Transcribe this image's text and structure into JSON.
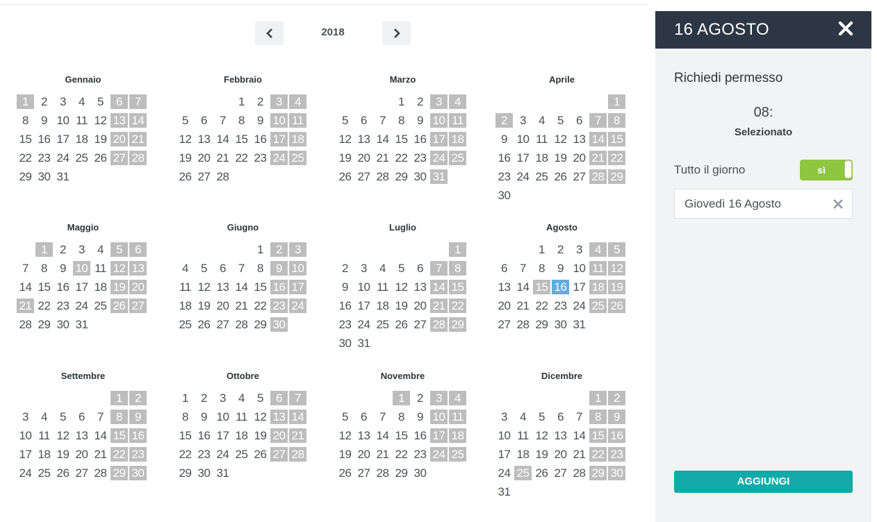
{
  "year_nav": {
    "year": "2018",
    "prev_icon": "chevron-left-icon",
    "next_icon": "chevron-right-icon"
  },
  "months": [
    {
      "name": "Gennaio",
      "offset": 0,
      "days": 31,
      "weekend": [
        1,
        6,
        7,
        13,
        14,
        20,
        21,
        27,
        28
      ],
      "holiday": []
    },
    {
      "name": "Febbraio",
      "offset": 3,
      "days": 28,
      "weekend": [
        3,
        4,
        10,
        11,
        17,
        18,
        24,
        25
      ],
      "holiday": []
    },
    {
      "name": "Marzo",
      "offset": 3,
      "days": 31,
      "weekend": [
        3,
        4,
        10,
        11,
        17,
        18,
        24,
        25,
        31
      ],
      "holiday": []
    },
    {
      "name": "Aprile",
      "offset": 6,
      "days": 30,
      "weekend": [
        1,
        2,
        7,
        8,
        14,
        15,
        21,
        22,
        28,
        29
      ],
      "holiday": []
    },
    {
      "name": "Maggio",
      "offset": 1,
      "days": 31,
      "weekend": [
        1,
        5,
        6,
        10,
        12,
        13,
        19,
        20,
        21,
        26,
        27
      ],
      "holiday": []
    },
    {
      "name": "Giugno",
      "offset": 4,
      "days": 30,
      "weekend": [
        2,
        3,
        9,
        10,
        16,
        17,
        23,
        24,
        30
      ],
      "holiday": []
    },
    {
      "name": "Luglio",
      "offset": 6,
      "days": 31,
      "weekend": [
        1,
        7,
        8,
        14,
        15,
        21,
        22,
        28,
        29
      ],
      "holiday": []
    },
    {
      "name": "Agosto",
      "offset": 2,
      "days": 31,
      "weekend": [
        4,
        5,
        11,
        12,
        15,
        18,
        19,
        25,
        26
      ],
      "holiday": [],
      "selected": 16
    },
    {
      "name": "Settembre",
      "offset": 5,
      "days": 30,
      "weekend": [
        1,
        2,
        8,
        9,
        15,
        16,
        22,
        23,
        29,
        30
      ],
      "holiday": []
    },
    {
      "name": "Ottobre",
      "offset": 0,
      "days": 31,
      "weekend": [
        6,
        7,
        13,
        14,
        20,
        21,
        27,
        28
      ],
      "holiday": []
    },
    {
      "name": "Novembre",
      "offset": 3,
      "days": 30,
      "weekend": [
        1,
        3,
        4,
        10,
        11,
        17,
        18,
        24,
        25
      ],
      "holiday": []
    },
    {
      "name": "Dicembre",
      "offset": 5,
      "days": 31,
      "weekend": [
        1,
        2,
        8,
        9,
        15,
        16,
        22,
        23,
        25,
        29,
        30
      ],
      "holiday": []
    }
  ],
  "panel": {
    "title": "16 AGOSTO",
    "close_icon": "close-icon",
    "section_title": "Richiedi permesso",
    "time_value": "08:",
    "selected_label": "Selezionato",
    "allday_label": "Tutto il giorno",
    "toggle_label": "sì",
    "toggle_on": true,
    "date_value": "Giovedì 16 Agosto",
    "clear_icon": "clear-icon",
    "add_button": "AGGIUNGI"
  },
  "colors": {
    "weekend_bg": "#bdbdbd",
    "selected_bg": "#5aaee3",
    "header_bg": "#2d3644",
    "toggle_bg": "#8dc63f",
    "add_button_bg": "#12aaa8"
  }
}
